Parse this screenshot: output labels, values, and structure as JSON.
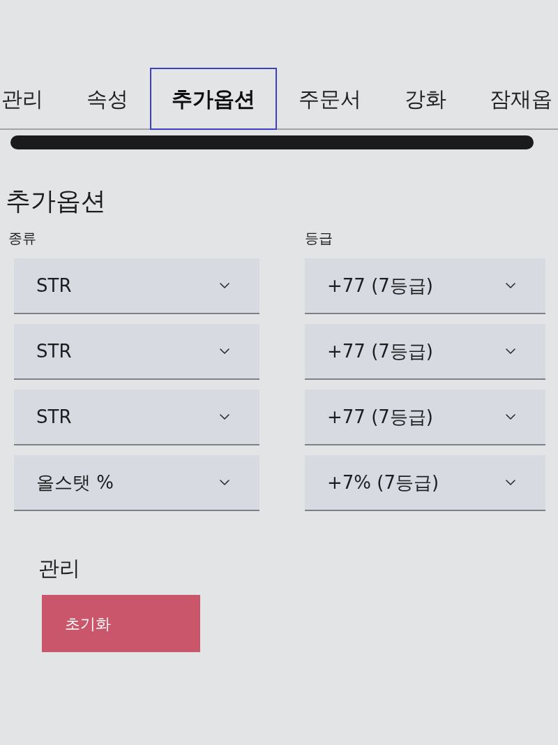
{
  "tabs": [
    {
      "label": "관리",
      "selected": false
    },
    {
      "label": "속성",
      "selected": false
    },
    {
      "label": "추가옵션",
      "selected": true
    },
    {
      "label": "주문서",
      "selected": false
    },
    {
      "label": "강화",
      "selected": false
    },
    {
      "label": "잠재옵",
      "selected": false
    }
  ],
  "additional_options": {
    "title": "추가옵션",
    "type_label": "종류",
    "grade_label": "등급",
    "rows": [
      {
        "type": "STR",
        "grade": "+77 (7등급)"
      },
      {
        "type": "STR",
        "grade": "+77 (7등급)"
      },
      {
        "type": "STR",
        "grade": "+77 (7등급)"
      },
      {
        "type": "올스탯 %",
        "grade": "+7% (7등급)"
      }
    ]
  },
  "management": {
    "title": "관리",
    "reset_button": "초기화"
  }
}
